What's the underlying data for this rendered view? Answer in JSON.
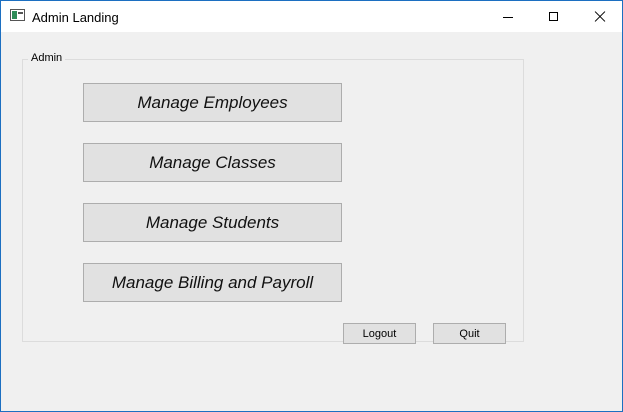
{
  "window": {
    "title": "Admin Landing",
    "app_icon": "app-window-icon"
  },
  "titlebar_controls": {
    "minimize": "minimize-icon",
    "maximize": "maximize-icon",
    "close": "close-icon"
  },
  "group": {
    "label": "Admin",
    "buttons": [
      {
        "label": "Manage Employees"
      },
      {
        "label": "Manage Classes"
      },
      {
        "label": "Manage Students"
      },
      {
        "label": "Manage Billing and Payroll"
      }
    ]
  },
  "footer": {
    "logout_label": "Logout",
    "quit_label": "Quit"
  },
  "colors": {
    "window_border": "#1c6fc1",
    "background": "#f0f0f0",
    "button_face": "#e1e1e1",
    "button_border": "#adadad"
  }
}
